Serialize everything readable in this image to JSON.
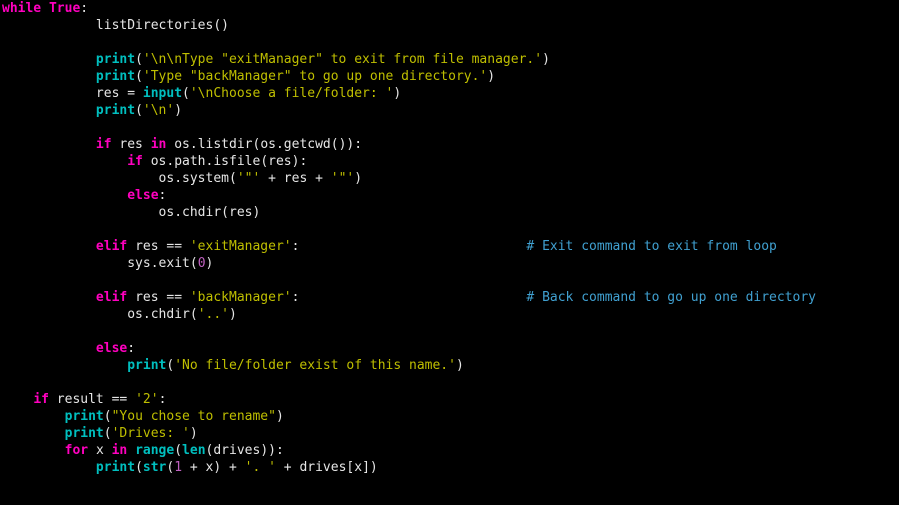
{
  "code_lines": [
    [
      {
        "cls": "kw",
        "t": "while"
      },
      {
        "cls": "pun",
        "t": " "
      },
      {
        "cls": "bool",
        "t": "True"
      },
      {
        "cls": "pun",
        "t": ":"
      }
    ],
    [
      {
        "cls": "pun",
        "t": "            "
      },
      {
        "cls": "obj",
        "t": "listDirectories"
      },
      {
        "cls": "pun",
        "t": "()"
      }
    ],
    [],
    [
      {
        "cls": "pun",
        "t": "            "
      },
      {
        "cls": "call",
        "t": "print"
      },
      {
        "cls": "pun",
        "t": "("
      },
      {
        "cls": "str",
        "t": "'\\n\\nType \"exitManager\" to exit from file manager.'"
      },
      {
        "cls": "pun",
        "t": ")"
      }
    ],
    [
      {
        "cls": "pun",
        "t": "            "
      },
      {
        "cls": "call",
        "t": "print"
      },
      {
        "cls": "pun",
        "t": "("
      },
      {
        "cls": "str",
        "t": "'Type \"backManager\" to go up one directory.'"
      },
      {
        "cls": "pun",
        "t": ")"
      }
    ],
    [
      {
        "cls": "pun",
        "t": "            "
      },
      {
        "cls": "obj",
        "t": "res"
      },
      {
        "cls": "pun",
        "t": " = "
      },
      {
        "cls": "call",
        "t": "input"
      },
      {
        "cls": "pun",
        "t": "("
      },
      {
        "cls": "str",
        "t": "'\\nChoose a file/folder: '"
      },
      {
        "cls": "pun",
        "t": ")"
      }
    ],
    [
      {
        "cls": "pun",
        "t": "            "
      },
      {
        "cls": "call",
        "t": "print"
      },
      {
        "cls": "pun",
        "t": "("
      },
      {
        "cls": "str",
        "t": "'\\n'"
      },
      {
        "cls": "pun",
        "t": ")"
      }
    ],
    [],
    [
      {
        "cls": "pun",
        "t": "            "
      },
      {
        "cls": "kw",
        "t": "if"
      },
      {
        "cls": "pun",
        "t": " "
      },
      {
        "cls": "obj",
        "t": "res"
      },
      {
        "cls": "pun",
        "t": " "
      },
      {
        "cls": "kw",
        "t": "in"
      },
      {
        "cls": "pun",
        "t": " "
      },
      {
        "cls": "obj",
        "t": "os"
      },
      {
        "cls": "pun",
        "t": "."
      },
      {
        "cls": "obj",
        "t": "listdir"
      },
      {
        "cls": "pun",
        "t": "("
      },
      {
        "cls": "obj",
        "t": "os"
      },
      {
        "cls": "pun",
        "t": "."
      },
      {
        "cls": "obj",
        "t": "getcwd"
      },
      {
        "cls": "pun",
        "t": "()):"
      }
    ],
    [
      {
        "cls": "pun",
        "t": "                "
      },
      {
        "cls": "kw",
        "t": "if"
      },
      {
        "cls": "pun",
        "t": " "
      },
      {
        "cls": "obj",
        "t": "os"
      },
      {
        "cls": "pun",
        "t": "."
      },
      {
        "cls": "obj",
        "t": "path"
      },
      {
        "cls": "pun",
        "t": "."
      },
      {
        "cls": "obj",
        "t": "isfile"
      },
      {
        "cls": "pun",
        "t": "("
      },
      {
        "cls": "obj",
        "t": "res"
      },
      {
        "cls": "pun",
        "t": "):"
      }
    ],
    [
      {
        "cls": "pun",
        "t": "                    "
      },
      {
        "cls": "obj",
        "t": "os"
      },
      {
        "cls": "pun",
        "t": "."
      },
      {
        "cls": "obj",
        "t": "system"
      },
      {
        "cls": "pun",
        "t": "("
      },
      {
        "cls": "str",
        "t": "'\"'"
      },
      {
        "cls": "pun",
        "t": " + "
      },
      {
        "cls": "obj",
        "t": "res"
      },
      {
        "cls": "pun",
        "t": " + "
      },
      {
        "cls": "str",
        "t": "'\"'"
      },
      {
        "cls": "pun",
        "t": ")"
      }
    ],
    [
      {
        "cls": "pun",
        "t": "                "
      },
      {
        "cls": "kw",
        "t": "else"
      },
      {
        "cls": "pun",
        "t": ":"
      }
    ],
    [
      {
        "cls": "pun",
        "t": "                    "
      },
      {
        "cls": "obj",
        "t": "os"
      },
      {
        "cls": "pun",
        "t": "."
      },
      {
        "cls": "obj",
        "t": "chdir"
      },
      {
        "cls": "pun",
        "t": "("
      },
      {
        "cls": "obj",
        "t": "res"
      },
      {
        "cls": "pun",
        "t": ")"
      }
    ],
    [],
    [
      {
        "cls": "pun",
        "t": "            "
      },
      {
        "cls": "kw",
        "t": "elif"
      },
      {
        "cls": "pun",
        "t": " "
      },
      {
        "cls": "obj",
        "t": "res"
      },
      {
        "cls": "pun",
        "t": " == "
      },
      {
        "cls": "str",
        "t": "'exitManager'"
      },
      {
        "cls": "pun",
        "t": ":"
      },
      {
        "cls": "pun",
        "t": "                             "
      },
      {
        "cls": "cmt",
        "t": "# Exit command to exit from loop"
      }
    ],
    [
      {
        "cls": "pun",
        "t": "                "
      },
      {
        "cls": "obj",
        "t": "sys"
      },
      {
        "cls": "pun",
        "t": "."
      },
      {
        "cls": "obj",
        "t": "exit"
      },
      {
        "cls": "pun",
        "t": "("
      },
      {
        "cls": "num",
        "t": "0"
      },
      {
        "cls": "pun",
        "t": ")"
      }
    ],
    [],
    [
      {
        "cls": "pun",
        "t": "            "
      },
      {
        "cls": "kw",
        "t": "elif"
      },
      {
        "cls": "pun",
        "t": " "
      },
      {
        "cls": "obj",
        "t": "res"
      },
      {
        "cls": "pun",
        "t": " == "
      },
      {
        "cls": "str",
        "t": "'backManager'"
      },
      {
        "cls": "pun",
        "t": ":"
      },
      {
        "cls": "pun",
        "t": "                             "
      },
      {
        "cls": "cmt",
        "t": "# Back command to go up one directory"
      }
    ],
    [
      {
        "cls": "pun",
        "t": "                "
      },
      {
        "cls": "obj",
        "t": "os"
      },
      {
        "cls": "pun",
        "t": "."
      },
      {
        "cls": "obj",
        "t": "chdir"
      },
      {
        "cls": "pun",
        "t": "("
      },
      {
        "cls": "str",
        "t": "'..'"
      },
      {
        "cls": "pun",
        "t": ")"
      }
    ],
    [],
    [
      {
        "cls": "pun",
        "t": "            "
      },
      {
        "cls": "kw",
        "t": "else"
      },
      {
        "cls": "pun",
        "t": ":"
      }
    ],
    [
      {
        "cls": "pun",
        "t": "                "
      },
      {
        "cls": "call",
        "t": "print"
      },
      {
        "cls": "pun",
        "t": "("
      },
      {
        "cls": "str",
        "t": "'No file/folder exist of this name.'"
      },
      {
        "cls": "pun",
        "t": ")"
      }
    ],
    [],
    [
      {
        "cls": "pun",
        "t": "    "
      },
      {
        "cls": "kw",
        "t": "if"
      },
      {
        "cls": "pun",
        "t": " "
      },
      {
        "cls": "obj",
        "t": "result"
      },
      {
        "cls": "pun",
        "t": " == "
      },
      {
        "cls": "str",
        "t": "'2'"
      },
      {
        "cls": "pun",
        "t": ":"
      }
    ],
    [
      {
        "cls": "pun",
        "t": "        "
      },
      {
        "cls": "call",
        "t": "print"
      },
      {
        "cls": "pun",
        "t": "("
      },
      {
        "cls": "str",
        "t": "\"You chose to rename\""
      },
      {
        "cls": "pun",
        "t": ")"
      }
    ],
    [
      {
        "cls": "pun",
        "t": "        "
      },
      {
        "cls": "call",
        "t": "print"
      },
      {
        "cls": "pun",
        "t": "("
      },
      {
        "cls": "str",
        "t": "'Drives: '"
      },
      {
        "cls": "pun",
        "t": ")"
      }
    ],
    [
      {
        "cls": "pun",
        "t": "        "
      },
      {
        "cls": "kw",
        "t": "for"
      },
      {
        "cls": "pun",
        "t": " "
      },
      {
        "cls": "obj",
        "t": "x"
      },
      {
        "cls": "pun",
        "t": " "
      },
      {
        "cls": "kw",
        "t": "in"
      },
      {
        "cls": "pun",
        "t": " "
      },
      {
        "cls": "call",
        "t": "range"
      },
      {
        "cls": "pun",
        "t": "("
      },
      {
        "cls": "call",
        "t": "len"
      },
      {
        "cls": "pun",
        "t": "("
      },
      {
        "cls": "obj",
        "t": "drives"
      },
      {
        "cls": "pun",
        "t": ")):"
      }
    ],
    [
      {
        "cls": "pun",
        "t": "            "
      },
      {
        "cls": "call",
        "t": "print"
      },
      {
        "cls": "pun",
        "t": "("
      },
      {
        "cls": "call",
        "t": "str"
      },
      {
        "cls": "pun",
        "t": "("
      },
      {
        "cls": "num",
        "t": "1"
      },
      {
        "cls": "pun",
        "t": " + "
      },
      {
        "cls": "obj",
        "t": "x"
      },
      {
        "cls": "pun",
        "t": ") + "
      },
      {
        "cls": "str",
        "t": "'. '"
      },
      {
        "cls": "pun",
        "t": " + "
      },
      {
        "cls": "obj",
        "t": "drives"
      },
      {
        "cls": "pun",
        "t": "["
      },
      {
        "cls": "obj",
        "t": "x"
      },
      {
        "cls": "pun",
        "t": "])"
      }
    ]
  ]
}
